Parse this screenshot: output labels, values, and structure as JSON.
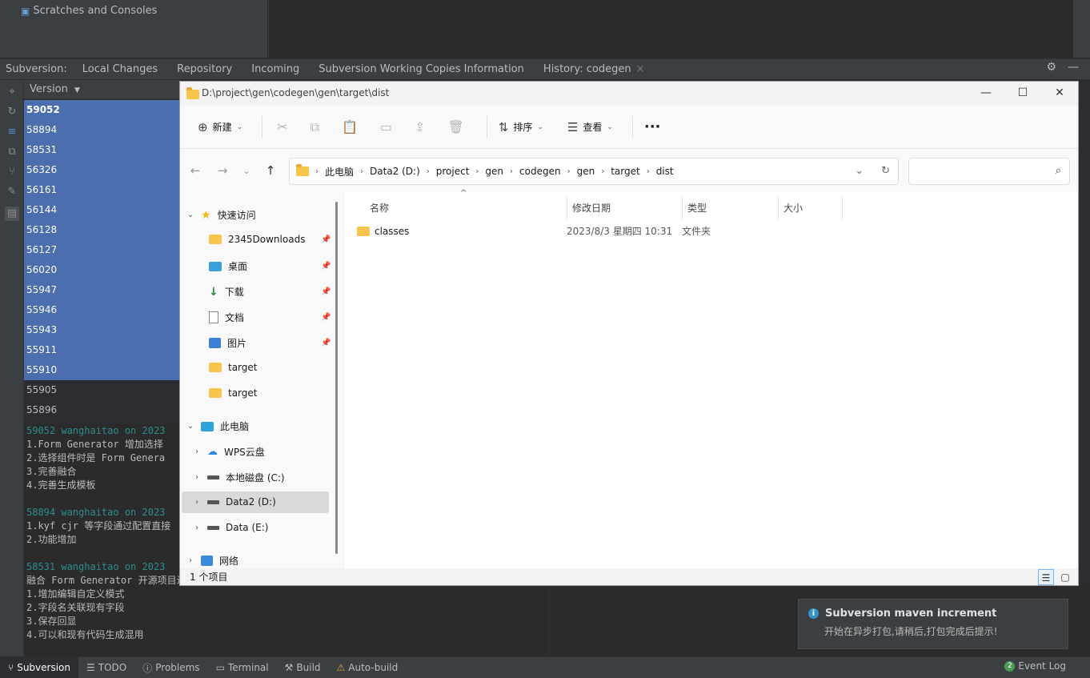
{
  "ide": {
    "scratches_label": "Scratches and Consoles",
    "svn_tabs": {
      "prefix": "Subversion:",
      "tabs": [
        "Local Changes",
        "Repository",
        "Incoming",
        "Subversion Working Copies Information",
        "History: codegen"
      ],
      "close": "×"
    },
    "version_header": "Version",
    "versions": [
      "59052",
      "58894",
      "58531",
      "56326",
      "56161",
      "56144",
      "56128",
      "56127",
      "56020",
      "55947",
      "55946",
      "55943",
      "55911",
      "55910",
      "55905",
      "55896"
    ],
    "log": [
      {
        "head": "59052 wanghaitao on 2023",
        "lines": [
          "1.Form Generator 增加选择",
          "2.选择组件时是 Form Genera",
          "3.完善融合",
          "4.完善生成模板"
        ]
      },
      {
        "head": "58894 wanghaitao on 2023",
        "lines": [
          "1.kyf cjr 等字段通过配置直接",
          "2.功能增加"
        ]
      },
      {
        "head": "58531 wanghaitao on 2023",
        "lines": [
          "融合 Form Generator 开源项目进入",
          "1.增加编辑自定义模式",
          "2.字段名关联现有字段",
          "3.保存回显",
          "4.可以和现有代码生成混用"
        ]
      }
    ],
    "status_bar": [
      "Subversion",
      "TODO",
      "Problems",
      "Terminal",
      "Build",
      "Auto-build"
    ],
    "event_log": "Event Log",
    "event_count": "2",
    "notification": {
      "title": "Subversion maven increment",
      "body": "开始在异步打包,请稍后,打包完成后提示!"
    }
  },
  "explorer": {
    "title": "D:\\project\\gen\\codegen\\gen\\target\\dist",
    "window_controls": [
      "—",
      "☐",
      "✕"
    ],
    "commands": {
      "new": "新建",
      "sort": "排序",
      "view": "查看",
      "more": "···"
    },
    "breadcrumb": [
      "此电脑",
      "Data2 (D:)",
      "project",
      "gen",
      "codegen",
      "gen",
      "target",
      "dist"
    ],
    "search_placeholder": "",
    "nav": {
      "quick_access": "快速访问",
      "quick_items": [
        "2345Downloads",
        "桌面",
        "下载",
        "文档",
        "图片",
        "target",
        "target"
      ],
      "this_pc": "此电脑",
      "pc_items": [
        "WPS云盘",
        "本地磁盘 (C:)",
        "Data2 (D:)",
        "Data (E:)"
      ],
      "network": "网络"
    },
    "columns": [
      "名称",
      "修改日期",
      "类型",
      "大小"
    ],
    "files": [
      {
        "name": "classes",
        "modified": "2023/8/3 星期四 10:31",
        "type": "文件夹",
        "size": ""
      }
    ],
    "item_count": "1 个项目"
  }
}
